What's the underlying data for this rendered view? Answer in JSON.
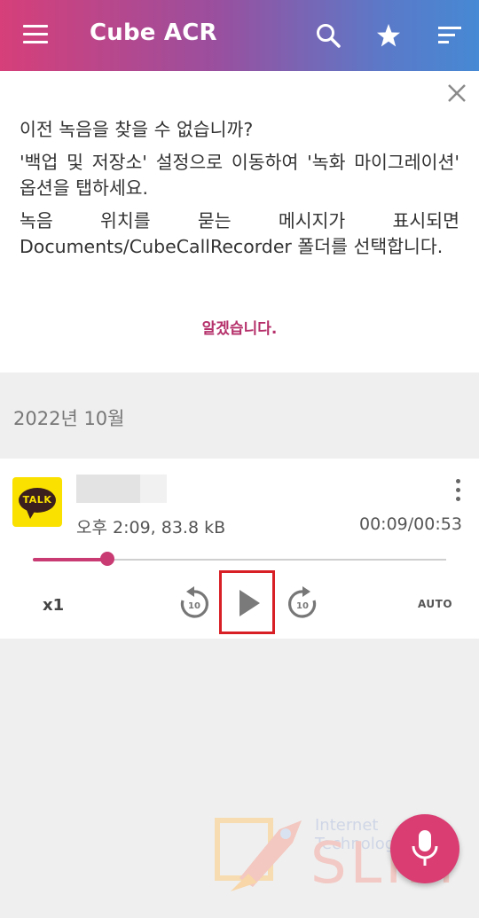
{
  "appbar": {
    "title": "Cube ACR",
    "icons": [
      "menu-icon",
      "search-icon",
      "star-icon",
      "sort-icon"
    ]
  },
  "notice": {
    "line1": "이전 녹음을 찾을 수 없습니까?",
    "line2": "'백업 및 저장소' 설정으로 이동하여 '녹화 마이그레이션' 옵션을 탭하세요.",
    "line3": "녹음 위치를 묻는 메시지가 표시되면 Documents/CubeCallRecorder 폴더를 선택합니다.",
    "ok_label": "알겠습니다."
  },
  "section": {
    "date_header": "2022년 10월"
  },
  "recording": {
    "app_icon_text": "TALK",
    "time_size": "오후 2:09, 83.8 kB",
    "position_duration": "00:09/00:53",
    "progress": 0.18,
    "speed_label": "x1",
    "rewind_seconds": "10",
    "forward_seconds": "10",
    "auto_label": "AUTO"
  },
  "watermark": {
    "line1": "Internet Technology",
    "line2": "SLIM"
  },
  "colors": {
    "accent": "#c83b73",
    "highlight_box": "#d81f26",
    "kakao_yellow": "#fae100"
  }
}
